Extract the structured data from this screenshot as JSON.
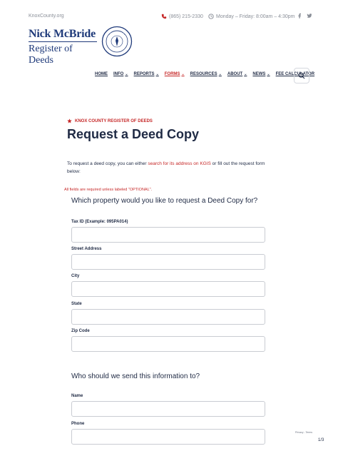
{
  "topbar": {
    "site": "KnoxCounty.org",
    "phone": "(865) 215-2330",
    "hours": "Monday – Friday: 8:00am – 4:30pm",
    "social": [
      "facebook-icon",
      "twitter-icon"
    ]
  },
  "logo": {
    "name": "Nick McBride",
    "title": "Register of Deeds",
    "seal_text": "OFFICIAL SEAL"
  },
  "nav": {
    "items": [
      {
        "label": "HOME",
        "dropdown": false
      },
      {
        "label": "INFO",
        "dropdown": true
      },
      {
        "label": "REPORTS",
        "dropdown": true
      },
      {
        "label": "FORMS",
        "dropdown": true
      },
      {
        "label": "RESOURCES",
        "dropdown": true
      },
      {
        "label": "ABOUT",
        "dropdown": true
      },
      {
        "label": "NEWS",
        "dropdown": true
      },
      {
        "label": "FEE CALCULATOR",
        "dropdown": false
      }
    ],
    "active_index": 3
  },
  "eyebrow": "KNOX COUNTY REGISTER OF DEEDS",
  "page_title": "Request a Deed Copy",
  "intro": {
    "before": "To request a deed copy, you can either ",
    "link": "search for its address on KGIS",
    "after": " or fill out the request form below:"
  },
  "required_note": "All fields are required unless labeled \"OPTIONAL\".",
  "sections": [
    {
      "title": "Which property would you like to request a Deed Copy for?"
    },
    {
      "title": "Who should we send this information to?"
    }
  ],
  "fields": [
    {
      "label": "Tax ID (Example: 095PA014)",
      "value": "",
      "placeholder": ""
    },
    {
      "label": "Street Address",
      "value": "",
      "placeholder": ""
    },
    {
      "label": "City",
      "value": "",
      "placeholder": ""
    },
    {
      "label": "State",
      "value": "",
      "placeholder": ""
    },
    {
      "label": "Zip Code",
      "value": "",
      "placeholder": ""
    },
    {
      "label": "Name",
      "value": "",
      "placeholder": ""
    },
    {
      "label": "Phone",
      "value": "",
      "placeholder": ""
    }
  ],
  "footer": {
    "links": "Privacy - Terms",
    "page": "1/3"
  },
  "colors": {
    "accent": "#c62828",
    "navy": "#1f3a7a",
    "text": "#1f2a44"
  }
}
